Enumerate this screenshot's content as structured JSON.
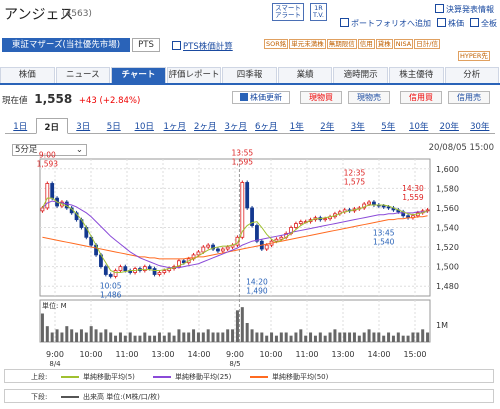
{
  "stock": {
    "name": "アンジェス",
    "code": "(4563)"
  },
  "top_boxes": [
    {
      "l1": "スマート",
      "l2": "アラート"
    },
    {
      "l1": "1R",
      "l2": "T.V."
    }
  ],
  "top_links": [
    "決算発表情報",
    "ポートフォリオへ追加",
    "株価",
    "全板"
  ],
  "market": {
    "primary": "東証マザーズ(当社優先市場)",
    "pts": "PTS",
    "pts_chart": "PTS株価計算"
  },
  "tags": [
    "SOR銘",
    "単元未満株",
    "無期限信",
    "信用",
    "貸株",
    "NISA",
    "日計/信",
    "HYPER先"
  ],
  "nav_tabs": [
    "株価",
    "ニュース",
    "チャート",
    "評価レポート",
    "四季報",
    "業績",
    "適時開示",
    "株主優待",
    "分析"
  ],
  "active_tab": 2,
  "price": {
    "label": "現在値",
    "value": "1,558",
    "change": "+43 (+2.84%)"
  },
  "buttons": {
    "refresh": "株価更新",
    "buy": "現物買",
    "sell": "現物売",
    "margin_buy": "信用買",
    "margin_sell": "信用売"
  },
  "period_tabs": [
    "1日",
    "2日",
    "3日",
    "5日",
    "10日",
    "1ヶ月",
    "2ヶ月",
    "3ヶ月",
    "6ヶ月",
    "1年",
    "2年",
    "3年",
    "5年",
    "10年",
    "20年",
    "30年"
  ],
  "active_period": 1,
  "interval": "5分足",
  "chart_date": "20/08/05 15:00",
  "colors": {
    "up": "#d22",
    "down": "#13388f",
    "ma5": "#a0c030",
    "ma25": "#8a4ad8",
    "ma50": "#ff6a20",
    "accent": "#2a63b8"
  },
  "chart_data": {
    "type": "line",
    "y_ticks": [
      1480,
      1500,
      1520,
      1540,
      1560,
      1580,
      1600
    ],
    "ylim": [
      1470,
      1610
    ],
    "x_ticks": [
      "9:00",
      "10:00",
      "11:00",
      "13:00",
      "14:00",
      "9:00",
      "10:00",
      "11:00",
      "13:00",
      "14:00",
      "15:00"
    ],
    "x_sub": [
      {
        "idx": 0,
        "text": "8/4"
      },
      {
        "idx": 5,
        "text": "8/5"
      }
    ],
    "annotations": [
      {
        "time": "9:00",
        "value": "1,593",
        "kind": "high"
      },
      {
        "time": "13:55",
        "value": "1,595",
        "kind": "high"
      },
      {
        "time": "12:35",
        "value": "1,575",
        "kind": "high"
      },
      {
        "time": "14:30",
        "value": "1,559",
        "kind": "high"
      },
      {
        "time": "10:05",
        "value": "1,486",
        "kind": "low"
      },
      {
        "time": "14:20",
        "value": "1,490",
        "kind": "low"
      },
      {
        "time": "13:45",
        "value": "1,540",
        "kind": "low"
      }
    ],
    "price": [
      1560,
      1585,
      1570,
      1562,
      1566,
      1560,
      1555,
      1548,
      1540,
      1530,
      1522,
      1512,
      1500,
      1492,
      1490,
      1496,
      1500,
      1496,
      1494,
      1498,
      1496,
      1500,
      1498,
      1492,
      1494,
      1496,
      1498,
      1500,
      1506,
      1504,
      1508,
      1512,
      1515,
      1520,
      1522,
      1518,
      1516,
      1518,
      1520,
      1522,
      1530,
      1586,
      1560,
      1542,
      1526,
      1518,
      1522,
      1526,
      1528,
      1530,
      1534,
      1540,
      1544,
      1546,
      1546,
      1548,
      1550,
      1548,
      1549,
      1551,
      1554,
      1556,
      1558,
      1557,
      1559,
      1560,
      1564,
      1566,
      1563,
      1562,
      1561,
      1560,
      1558,
      1556,
      1552,
      1550,
      1552,
      1555,
      1557,
      1558
    ],
    "ma5": [
      1560,
      1570,
      1570,
      1566,
      1564,
      1562,
      1559,
      1554,
      1548,
      1540,
      1531,
      1522,
      1512,
      1504,
      1496,
      1494,
      1494,
      1495,
      1496,
      1496,
      1497,
      1497,
      1497,
      1496,
      1496,
      1497,
      1498,
      1499,
      1501,
      1503,
      1506,
      1508,
      1511,
      1514,
      1517,
      1519,
      1520,
      1521,
      1521,
      1522,
      1524,
      1536,
      1542,
      1545,
      1546,
      1540,
      1533,
      1528,
      1525,
      1527,
      1530,
      1534,
      1538,
      1542,
      1545,
      1547,
      1549,
      1549,
      1550,
      1551,
      1552,
      1554,
      1556,
      1557,
      1558,
      1559,
      1561,
      1563,
      1563,
      1563,
      1563,
      1562,
      1560,
      1558,
      1556,
      1554,
      1553,
      1554,
      1555,
      1557
    ],
    "ma25": [
      1560,
      1565,
      1567,
      1566,
      1565,
      1564,
      1563,
      1561,
      1558,
      1555,
      1551,
      1546,
      1541,
      1536,
      1531,
      1527,
      1523,
      1519,
      1515,
      1512,
      1509,
      1507,
      1505,
      1503,
      1501,
      1500,
      1499,
      1499,
      1499,
      1500,
      1501,
      1502,
      1503,
      1505,
      1507,
      1509,
      1511,
      1513,
      1515,
      1517,
      1519,
      1522,
      1524,
      1526,
      1527,
      1528,
      1529,
      1530,
      1531,
      1532,
      1533,
      1535,
      1536,
      1537,
      1538,
      1539,
      1540,
      1541,
      1542,
      1543,
      1544,
      1545,
      1546,
      1547,
      1548,
      1549,
      1550,
      1551,
      1552,
      1553,
      1553,
      1554,
      1554,
      1555,
      1555,
      1555,
      1555,
      1556,
      1556,
      1556
    ],
    "ma50": [
      1530,
      1529,
      1528,
      1527,
      1526,
      1525,
      1524,
      1523,
      1522,
      1521,
      1520,
      1519,
      1518,
      1517,
      1516,
      1515,
      1514,
      1513,
      1512,
      1511,
      1510,
      1510,
      1509,
      1509,
      1508,
      1508,
      1508,
      1508,
      1508,
      1508,
      1509,
      1509,
      1510,
      1510,
      1511,
      1512,
      1513,
      1514,
      1515,
      1516,
      1517,
      1518,
      1519,
      1520,
      1521,
      1522,
      1523,
      1524,
      1525,
      1526,
      1527,
      1528,
      1529,
      1530,
      1531,
      1532,
      1533,
      1534,
      1535,
      1536,
      1537,
      1538,
      1539,
      1540,
      1541,
      1542,
      1543,
      1544,
      1545,
      1546,
      1547,
      1548,
      1548,
      1549,
      1549,
      1550,
      1550,
      1551,
      1551,
      1552
    ],
    "volume": [
      9,
      5,
      3,
      4,
      3,
      5,
      4,
      3,
      4,
      3,
      5,
      4,
      3,
      4,
      3,
      2,
      3,
      2,
      3,
      2,
      2,
      3,
      2,
      2,
      3,
      2,
      3,
      2,
      4,
      3,
      3,
      4,
      3,
      3,
      4,
      3,
      3,
      3,
      4,
      4,
      10,
      11,
      6,
      4,
      3,
      3,
      2,
      3,
      2,
      3,
      3,
      2,
      3,
      4,
      2,
      3,
      2,
      3,
      2,
      3,
      4,
      3,
      3,
      3,
      3,
      2,
      3,
      4,
      3,
      3,
      2,
      3,
      2,
      3,
      2,
      2,
      3,
      3,
      4,
      3
    ],
    "volume_label": "1M",
    "volume_unit": "単位: M"
  },
  "legends": {
    "upper_label": "上段:",
    "ma5": "単純移動平均(5)",
    "ma25": "単純移動平均(25)",
    "ma50": "単純移動平均(50)",
    "lower_label": "下段:",
    "volume": "出来高 単位:(M株/口/枚)"
  }
}
